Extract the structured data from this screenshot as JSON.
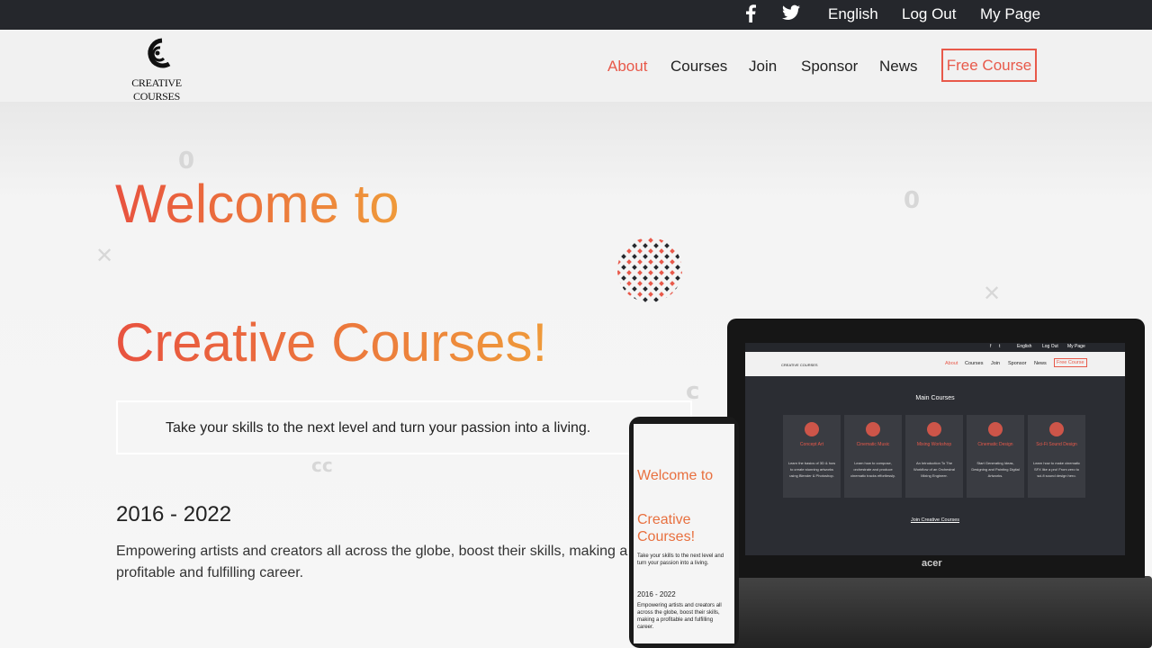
{
  "topbar": {
    "language": "English",
    "logout": "Log Out",
    "mypage": "My Page",
    "social": [
      "facebook-icon",
      "twitter-icon"
    ]
  },
  "header": {
    "logo_text": "CREATIVE COURSES",
    "nav": [
      "About",
      "Courses",
      "Join",
      "Sponsor",
      "News"
    ],
    "free_course": "Free Course"
  },
  "hero": {
    "title_line1": "Welcome to",
    "title_line2": "Creative Courses!",
    "tagline": "Take your skills to the next level and turn your passion into a living.",
    "years": "2016 - 2022",
    "description": "Empowering artists and creators all across the globe, boost their skills, making a profitable and fulfilling career."
  },
  "laptop": {
    "brand": "acer",
    "main_courses": "Main Courses",
    "join_link": "Join Creative Courses",
    "cards": [
      {
        "title": "Concept Art",
        "desc": "Learn the basics of 3D & how to create stunning artworks using Blender & Photoshop."
      },
      {
        "title": "Cinematic Music",
        "desc": "Learn how to compose, orchestrate and produce cinematic tracks effortlessly."
      },
      {
        "title": "Mixing Workshop",
        "desc": "An Introduction To The Workflow of an Orchestral Mixing Engineer."
      },
      {
        "title": "Cinematic Design",
        "desc": "Start Generating Ideas, Designing and Painting Digital Artworks."
      },
      {
        "title": "Sci-Fi Sound Design",
        "desc": "Learn how to make cinematic SFX like a pro! From zero to sci-fi sound design hero."
      }
    ]
  },
  "phone": {
    "title_line1": "Welcome to",
    "title_line2": "Creative Courses!",
    "tagline": "Take your skills to the next level and turn your passion into a living.",
    "years": "2016 - 2022",
    "description": "Empowering artists and creators all across the globe, boost their skills, making a profitable and fulfilling career."
  },
  "colors": {
    "accent": "#e8594a",
    "topbar": "#25272c",
    "gradient_start": "#e8523f",
    "gradient_end": "#ef9a3a"
  }
}
